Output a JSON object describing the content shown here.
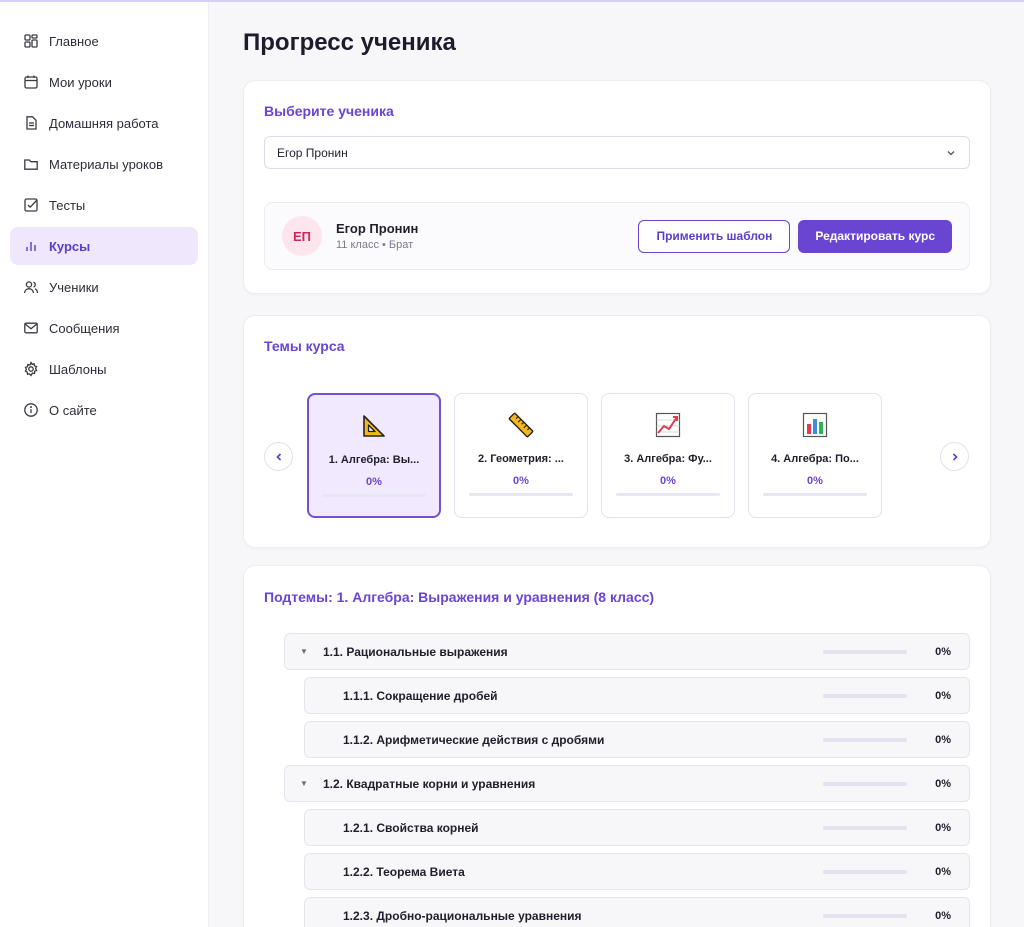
{
  "colors": {
    "accent": "#6a45d1",
    "accent_bg": "#efe8fd",
    "avatar_bg": "#fde5ee",
    "avatar_text": "#d0265f"
  },
  "sidebar": {
    "items": [
      {
        "label": "Главное",
        "icon": "dashboard-icon",
        "active": false
      },
      {
        "label": "Мои уроки",
        "icon": "calendar-icon",
        "active": false
      },
      {
        "label": "Домашняя работа",
        "icon": "document-icon",
        "active": false
      },
      {
        "label": "Материалы уроков",
        "icon": "folder-icon",
        "active": false
      },
      {
        "label": "Тесты",
        "icon": "checkbox-icon",
        "active": false
      },
      {
        "label": "Курсы",
        "icon": "bar-chart-icon",
        "active": true
      },
      {
        "label": "Ученики",
        "icon": "users-icon",
        "active": false
      },
      {
        "label": "Сообщения",
        "icon": "mail-icon",
        "active": false
      },
      {
        "label": "Шаблоны",
        "icon": "gear-icon",
        "active": false
      },
      {
        "label": "О сайте",
        "icon": "info-icon",
        "active": false
      }
    ]
  },
  "page": {
    "title": "Прогресс ученика"
  },
  "student_select": {
    "title": "Выберите ученика",
    "selected": "Егор Пронин"
  },
  "student": {
    "initials": "ЕП",
    "name": "Егор Пронин",
    "meta": "11 класс • Брат",
    "apply_template_label": "Применить шаблон",
    "edit_course_label": "Редактировать курс"
  },
  "topics": {
    "title": "Темы курса",
    "items": [
      {
        "name": "1. Алгебра: Вы...",
        "icon": "triangle-ruler-icon",
        "progress": 0,
        "progress_label": "0%",
        "active": true
      },
      {
        "name": "2. Геометрия: ...",
        "icon": "ruler-icon",
        "progress": 0,
        "progress_label": "0%",
        "active": false
      },
      {
        "name": "3. Алгебра: Фу...",
        "icon": "line-chart-icon",
        "progress": 0,
        "progress_label": "0%",
        "active": false
      },
      {
        "name": "4. Алгебра: По...",
        "icon": "bar-chart-emoji-icon",
        "progress": 0,
        "progress_label": "0%",
        "active": false
      }
    ]
  },
  "subtopics": {
    "title": "Подтемы: 1. Алгебра: Выражения и уравнения (8 класс)",
    "rows": [
      {
        "level": 1,
        "label": "1.1. Рациональные выражения",
        "progress": 0,
        "progress_label": "0%"
      },
      {
        "level": 2,
        "label": "1.1.1. Сокращение дробей",
        "progress": 0,
        "progress_label": "0%"
      },
      {
        "level": 2,
        "label": "1.1.2. Арифметические действия с дробями",
        "progress": 0,
        "progress_label": "0%"
      },
      {
        "level": 1,
        "label": "1.2. Квадратные корни и уравнения",
        "progress": 0,
        "progress_label": "0%"
      },
      {
        "level": 2,
        "label": "1.2.1. Свойства корней",
        "progress": 0,
        "progress_label": "0%"
      },
      {
        "level": 2,
        "label": "1.2.2. Теорема Виета",
        "progress": 0,
        "progress_label": "0%"
      },
      {
        "level": 2,
        "label": "1.2.3. Дробно-рациональные уравнения",
        "progress": 0,
        "progress_label": "0%"
      }
    ]
  }
}
